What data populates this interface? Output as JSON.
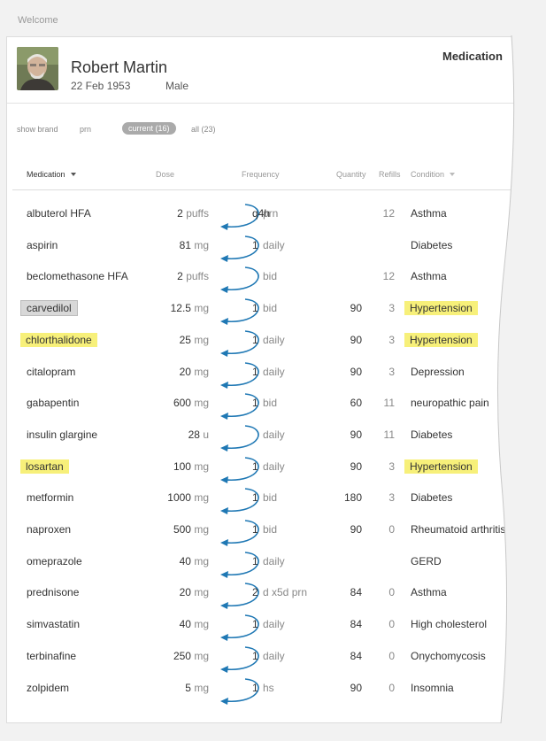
{
  "header": {
    "welcome": "Welcome"
  },
  "patient": {
    "name": "Robert Martin",
    "dob": "22 Feb 1953",
    "sex": "Male"
  },
  "panel": {
    "title": "Medication"
  },
  "filters": {
    "show_brand": "show brand",
    "prn": "prn",
    "current": "current (16)",
    "all": "all (23)"
  },
  "columns": {
    "medication": "Medication",
    "dose": "Dose",
    "frequency": "Frequency",
    "quantity": "Quantity",
    "refills": "Refills",
    "condition": "Condition"
  },
  "colors": {
    "highlight": "#f7f07a",
    "arrow": "#1f78b4",
    "selected": "#d8d8d8"
  },
  "rows": [
    {
      "med": "albuterol HFA",
      "dose": "2",
      "unit": "puffs",
      "freq_n": "q4h",
      "freq_u": "prn",
      "qty": "",
      "refills": "12",
      "cond": "Asthma",
      "med_style": "",
      "cond_hl": false
    },
    {
      "med": "aspirin",
      "dose": "81",
      "unit": "mg",
      "freq_n": "1",
      "freq_u": "daily",
      "qty": "",
      "refills": "",
      "cond": "Diabetes",
      "med_style": "",
      "cond_hl": false
    },
    {
      "med": "beclomethasone HFA",
      "dose": "2",
      "unit": "puffs",
      "freq_n": "",
      "freq_u": "bid",
      "qty": "",
      "refills": "12",
      "cond": "Asthma",
      "med_style": "",
      "cond_hl": false
    },
    {
      "med": "carvedilol",
      "dose": "12.5",
      "unit": "mg",
      "freq_n": "1",
      "freq_u": "bid",
      "qty": "90",
      "refills": "3",
      "cond": "Hypertension",
      "med_style": "sel",
      "cond_hl": true
    },
    {
      "med": "chlorthalidone",
      "dose": "25",
      "unit": "mg",
      "freq_n": "1",
      "freq_u": "daily",
      "qty": "90",
      "refills": "3",
      "cond": "Hypertension",
      "med_style": "hl",
      "cond_hl": true
    },
    {
      "med": "citalopram",
      "dose": "20",
      "unit": "mg",
      "freq_n": "1",
      "freq_u": "daily",
      "qty": "90",
      "refills": "3",
      "cond": "Depression",
      "med_style": "",
      "cond_hl": false
    },
    {
      "med": "gabapentin",
      "dose": "600",
      "unit": "mg",
      "freq_n": "1",
      "freq_u": "bid",
      "qty": "60",
      "refills": "11",
      "cond": "neuropathic pain",
      "med_style": "",
      "cond_hl": false
    },
    {
      "med": "insulin glargine",
      "dose": "28",
      "unit": "u",
      "freq_n": "",
      "freq_u": "daily",
      "qty": "90",
      "refills": "11",
      "cond": "Diabetes",
      "med_style": "",
      "cond_hl": false
    },
    {
      "med": "losartan",
      "dose": "100",
      "unit": "mg",
      "freq_n": "1",
      "freq_u": "daily",
      "qty": "90",
      "refills": "3",
      "cond": "Hypertension",
      "med_style": "hl",
      "cond_hl": true
    },
    {
      "med": "metformin",
      "dose": "1000",
      "unit": "mg",
      "freq_n": "1",
      "freq_u": "bid",
      "qty": "180",
      "refills": "3",
      "cond": "Diabetes",
      "med_style": "",
      "cond_hl": false
    },
    {
      "med": "naproxen",
      "dose": "500",
      "unit": "mg",
      "freq_n": "1",
      "freq_u": "bid",
      "qty": "90",
      "refills": "0",
      "cond": "Rheumatoid arthritis",
      "med_style": "",
      "cond_hl": false
    },
    {
      "med": "omeprazole",
      "dose": "40",
      "unit": "mg",
      "freq_n": "1",
      "freq_u": "daily",
      "qty": "",
      "refills": "",
      "cond": "GERD",
      "med_style": "",
      "cond_hl": false
    },
    {
      "med": "prednisone",
      "dose": "20",
      "unit": "mg",
      "freq_n": "2",
      "freq_u": "d x5d prn",
      "qty": "84",
      "refills": "0",
      "cond": "Asthma",
      "med_style": "",
      "cond_hl": false
    },
    {
      "med": "simvastatin",
      "dose": "40",
      "unit": "mg",
      "freq_n": "1",
      "freq_u": "daily",
      "qty": "84",
      "refills": "0",
      "cond": "High cholesterol",
      "med_style": "",
      "cond_hl": false
    },
    {
      "med": "terbinafine",
      "dose": "250",
      "unit": "mg",
      "freq_n": "1",
      "freq_u": "daily",
      "qty": "84",
      "refills": "0",
      "cond": "Onychomycosis",
      "med_style": "",
      "cond_hl": false
    },
    {
      "med": "zolpidem",
      "dose": "5",
      "unit": "mg",
      "freq_n": "1",
      "freq_u": "hs",
      "qty": "90",
      "refills": "0",
      "cond": "Insomnia",
      "med_style": "",
      "cond_hl": false
    }
  ]
}
